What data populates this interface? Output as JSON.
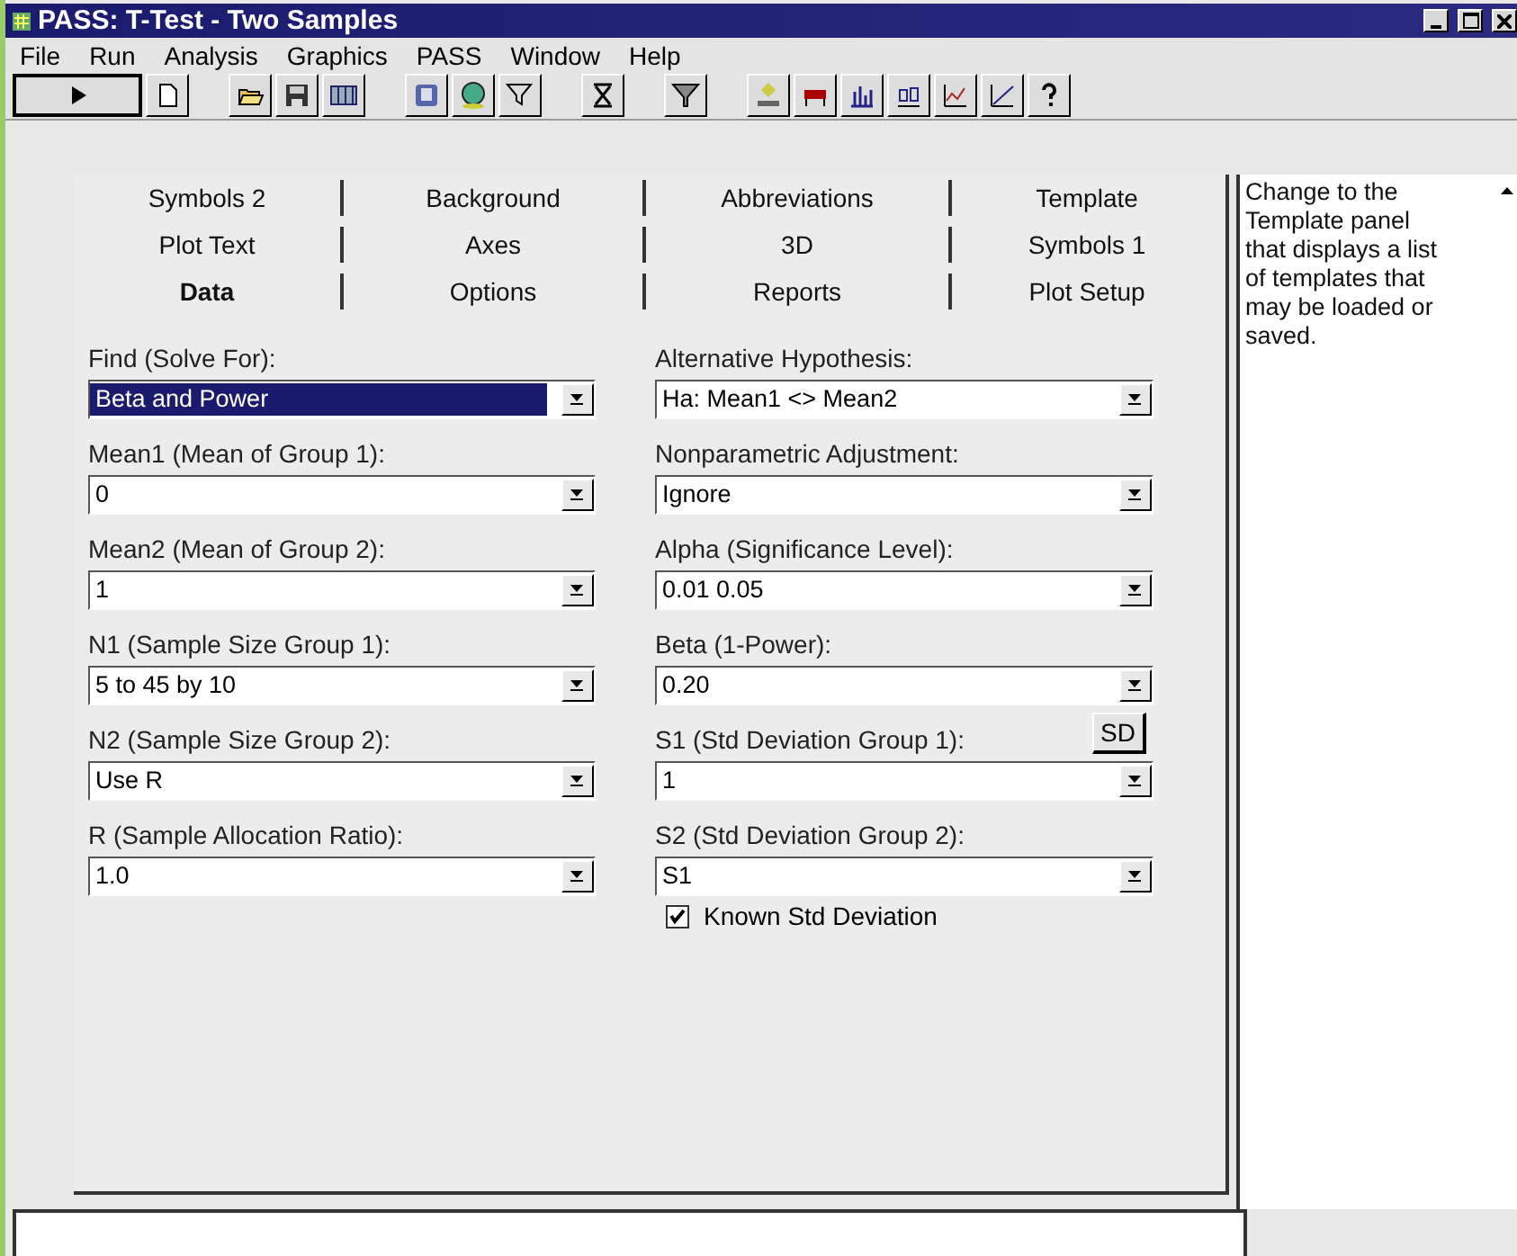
{
  "window": {
    "title": "PASS: T-Test - Two Samples"
  },
  "menu": [
    "File",
    "Run",
    "Analysis",
    "Graphics",
    "PASS",
    "Window",
    "Help"
  ],
  "tab_rows": [
    [
      {
        "label": "Symbols 2",
        "selected": false
      },
      {
        "label": "Background",
        "selected": false
      },
      {
        "label": "Abbreviations",
        "selected": false
      },
      {
        "label": "Template",
        "selected": false
      }
    ],
    [
      {
        "label": "Plot Text",
        "selected": false
      },
      {
        "label": "Axes",
        "selected": false
      },
      {
        "label": "3D",
        "selected": false
      },
      {
        "label": "Symbols 1",
        "selected": false
      }
    ],
    [
      {
        "label": "Data",
        "selected": true
      },
      {
        "label": "Options",
        "selected": false
      },
      {
        "label": "Reports",
        "selected": false
      },
      {
        "label": "Plot Setup",
        "selected": false
      }
    ]
  ],
  "left_fields": [
    {
      "label": "Find (Solve For):",
      "value": "Beta and Power",
      "highlighted": true
    },
    {
      "label": "Mean1 (Mean of Group 1):",
      "value": "0",
      "highlighted": false
    },
    {
      "label": "Mean2 (Mean of Group 2):",
      "value": "1",
      "highlighted": false
    },
    {
      "label": "N1 (Sample Size Group 1):",
      "value": "5 to 45 by 10",
      "highlighted": false
    },
    {
      "label": "N2 (Sample Size Group 2):",
      "value": "Use R",
      "highlighted": false
    },
    {
      "label": "R (Sample Allocation Ratio):",
      "value": "1.0",
      "highlighted": false
    }
  ],
  "right_fields": [
    {
      "label": "Alternative Hypothesis:",
      "value": "Ha: Mean1 <> Mean2",
      "highlighted": false
    },
    {
      "label": "Nonparametric Adjustment:",
      "value": "Ignore",
      "highlighted": false
    },
    {
      "label": "Alpha (Significance Level):",
      "value": "0.01 0.05",
      "highlighted": false
    },
    {
      "label": "Beta (1-Power):",
      "value": "0.20",
      "highlighted": false
    },
    {
      "label": "S1 (Std Deviation Group 1):",
      "value": "1",
      "highlighted": false,
      "button": "SD"
    },
    {
      "label": "S2 (Std Deviation Group 2):",
      "value": "S1",
      "highlighted": false
    }
  ],
  "known_std_deviation": {
    "label": "Known Std Deviation",
    "checked": true
  },
  "help_panel": {
    "text": "Change to the Template panel that displays a list of templates that may be loaded or saved."
  }
}
